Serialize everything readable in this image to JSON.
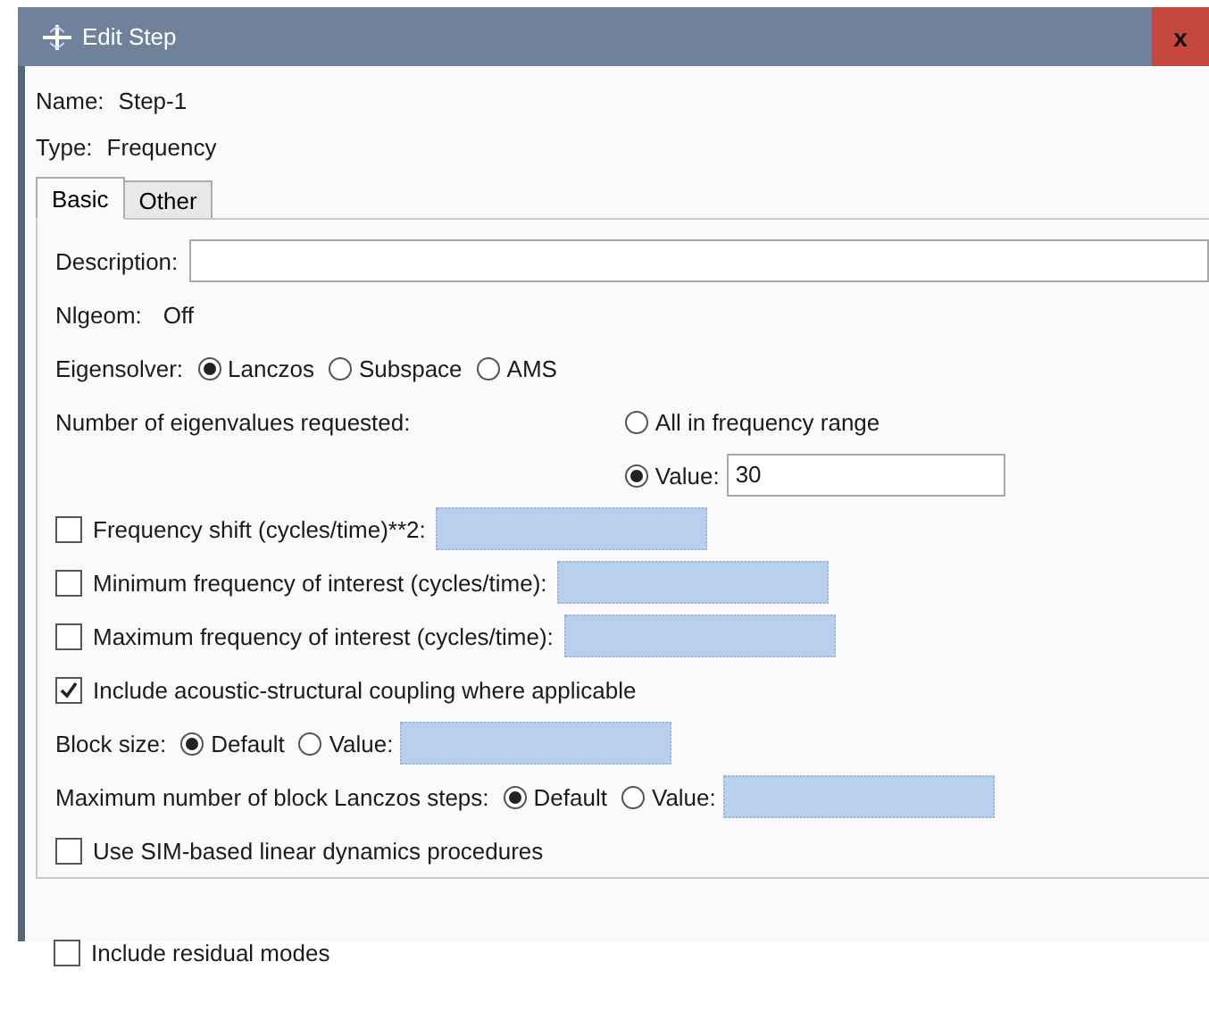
{
  "window": {
    "title": "Edit Step",
    "close": "x"
  },
  "info": [
    {
      "label": "Name:",
      "value": "Step-1"
    },
    {
      "label": "Type:",
      "value": "Frequency"
    }
  ],
  "tabs": [
    {
      "label": "Basic",
      "selected": true
    },
    {
      "label": "Other",
      "selected": false
    }
  ],
  "rows": [
    {
      "kind": "field",
      "label": "Description:"
    },
    {
      "kind": "info",
      "label": "Nlgeom:",
      "value": "Off"
    },
    {
      "kind": "radio",
      "label": "Eigensolver:",
      "options": [
        {
          "label": "Lanczos",
          "selected": true
        },
        {
          "label": "Subspace",
          "selected": false
        },
        {
          "label": "AMS",
          "selected": false
        }
      ]
    },
    {
      "kind": "radio-stack",
      "label": "Number of eigenvalues requested:",
      "options": [
        {
          "label": "All in frequency range",
          "selected": false
        },
        {
          "label": "Value:",
          "selected": true,
          "field": {
            "value": "30",
            "disabled": false
          }
        }
      ]
    },
    {
      "kind": "check",
      "label": "Frequency shift (cycles/time)**2:",
      "checked": false,
      "field": {
        "disabled": true
      }
    },
    {
      "kind": "check",
      "label": "Minimum frequency of interest (cycles/time):",
      "checked": false,
      "field": {
        "disabled": true
      }
    },
    {
      "kind": "check",
      "label": "Maximum frequency of interest (cycles/time):",
      "checked": false,
      "field": {
        "disabled": true
      }
    },
    {
      "kind": "check",
      "label": "Include acoustic-structural coupling where applicable",
      "checked": true
    },
    {
      "kind": "radio",
      "label": "Block size:",
      "options": [
        {
          "label": "Default",
          "selected": true
        },
        {
          "label": "Value:",
          "selected": false,
          "field": {
            "disabled": true
          }
        }
      ]
    },
    {
      "kind": "radio",
      "label": "Maximum number of block Lanczos steps:",
      "options": [
        {
          "label": "Default",
          "selected": true
        },
        {
          "label": "Value:",
          "selected": false,
          "field": {
            "disabled": true
          }
        }
      ]
    },
    {
      "kind": "check",
      "label": "Use SIM-based linear dynamics procedures",
      "checked": false
    }
  ],
  "footer_rows": [
    {
      "kind": "check",
      "label": "Include residual modes",
      "checked": false
    }
  ]
}
